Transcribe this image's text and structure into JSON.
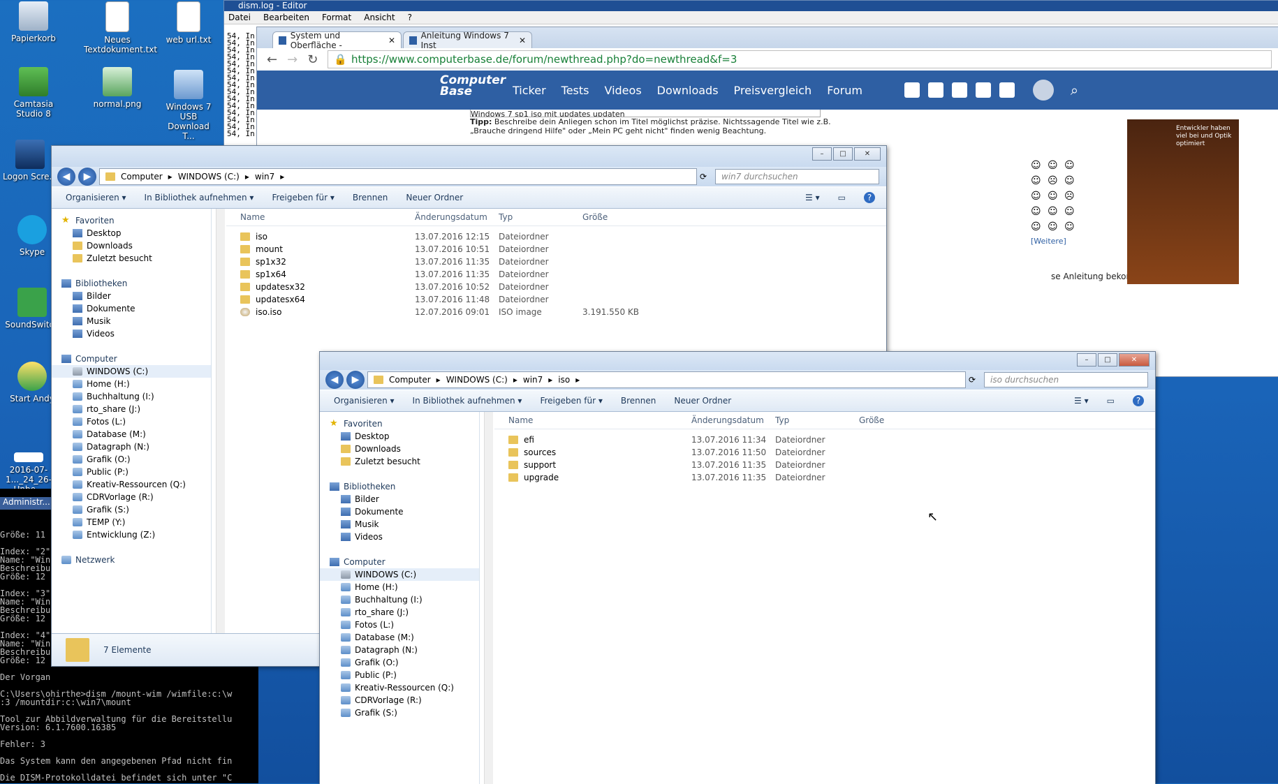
{
  "desktop_icons": [
    {
      "label": "Papierkorb"
    },
    {
      "label": "Neues Textdokument.txt"
    },
    {
      "label": "web url.txt"
    },
    {
      "label": "Camtasia Studio 8"
    },
    {
      "label": "normal.png"
    },
    {
      "label": "Windows 7 USB Download T..."
    },
    {
      "label": "Logon Scre..."
    },
    {
      "label": "Skype"
    },
    {
      "label": "SoundSwitch"
    },
    {
      "label": "Start Andy"
    },
    {
      "label": "2016-07-1..._24_26-Unbe..."
    }
  ],
  "editor": {
    "title": "dism.log - Editor",
    "menu": [
      "Datei",
      "Bearbeiten",
      "Format",
      "Ansicht",
      "?"
    ],
    "line_prefix": "54, In"
  },
  "browser": {
    "tabs": [
      {
        "label": "System und Oberfläche -"
      },
      {
        "label": "Anleitung Windows 7 Inst"
      }
    ],
    "url": "https://www.computerbase.de/forum/newthread.php?do=newthread&f=3",
    "nav_links": [
      "Ticker",
      "Tests",
      "Videos",
      "Downloads",
      "Preisvergleich",
      "Forum"
    ],
    "logo_text": "Computer Base",
    "tip_bold": "Tipp:",
    "tip_text": "Beschreibe dein Anliegen schon im Titel möglichst präzise. Nichtssagende Titel wie z.B. „Brauche dringend Hilfe\" oder „Mein PC geht nicht\" finden wenig Beachtung.",
    "thread_title": "Windows 7 sp1 iso mit updates updaten",
    "body_fragment": "se Anleitung bekomme ich",
    "more_smilies": "[Weitere]",
    "ad_headline": "Entwickler haben viel bei und Optik optimiert"
  },
  "console": {
    "title": "Administr...",
    "lines": [
      "Größe: 11",
      "",
      "Index: \"2\"",
      "Name: \"Win",
      "Beschreibu",
      "Größe: 12",
      "",
      "Index: \"3\"",
      "Name: \"Win",
      "Beschreibu",
      "Größe: 12",
      "",
      "Index: \"4\"",
      "Name: \"Win",
      "Beschreibu",
      "Größe: 12",
      "",
      "Der Vorgan",
      "",
      "C:\\Users\\ohirthe>dism /mount-wim /wimfile:c:\\w",
      ":3 /mountdir:c:\\win7\\mount",
      "",
      "Tool zur Abbildverwaltung für die Bereitstellu",
      "Version: 6.1.7600.16385",
      "",
      "Fehler: 3",
      "",
      "Das System kann den angegebenen Pfad nicht fin",
      "",
      "Die DISM-Protokolldatei befindet sich unter \"C"
    ]
  },
  "explorer_win7": {
    "breadcrumb": [
      "Computer",
      "WINDOWS (C:)",
      "win7"
    ],
    "search_placeholder": "win7 durchsuchen",
    "commands": [
      "Organisieren ▾",
      "In Bibliothek aufnehmen ▾",
      "Freigeben für ▾",
      "Brennen",
      "Neuer Ordner"
    ],
    "columns": {
      "name": "Name",
      "date": "Änderungsdatum",
      "type": "Typ",
      "size": "Größe"
    },
    "files": [
      {
        "name": "iso",
        "date": "13.07.2016 12:15",
        "type": "Dateiordner",
        "size": ""
      },
      {
        "name": "mount",
        "date": "13.07.2016 10:51",
        "type": "Dateiordner",
        "size": ""
      },
      {
        "name": "sp1x32",
        "date": "13.07.2016 11:35",
        "type": "Dateiordner",
        "size": ""
      },
      {
        "name": "sp1x64",
        "date": "13.07.2016 11:35",
        "type": "Dateiordner",
        "size": ""
      },
      {
        "name": "updatesx32",
        "date": "13.07.2016 10:52",
        "type": "Dateiordner",
        "size": ""
      },
      {
        "name": "updatesx64",
        "date": "13.07.2016 11:48",
        "type": "Dateiordner",
        "size": ""
      },
      {
        "name": "iso.iso",
        "date": "12.07.2016 09:01",
        "type": "ISO image",
        "size": "3.191.550 KB"
      }
    ],
    "status": "7 Elemente"
  },
  "explorer_iso": {
    "breadcrumb": [
      "Computer",
      "WINDOWS (C:)",
      "win7",
      "iso"
    ],
    "search_placeholder": "iso durchsuchen",
    "files": [
      {
        "name": "efi",
        "date": "13.07.2016 11:34",
        "type": "Dateiordner"
      },
      {
        "name": "sources",
        "date": "13.07.2016 11:50",
        "type": "Dateiordner"
      },
      {
        "name": "support",
        "date": "13.07.2016 11:35",
        "type": "Dateiordner"
      },
      {
        "name": "upgrade",
        "date": "13.07.2016 11:35",
        "type": "Dateiordner"
      }
    ]
  },
  "navpane": {
    "favorites": "Favoriten",
    "fav_items": [
      "Desktop",
      "Downloads",
      "Zuletzt besucht"
    ],
    "libraries": "Bibliotheken",
    "lib_items": [
      "Bilder",
      "Dokumente",
      "Musik",
      "Videos"
    ],
    "computer": "Computer",
    "drives": [
      "WINDOWS (C:)",
      "Home (H:)",
      "Buchhaltung (I:)",
      "rto_share (J:)",
      "Fotos (L:)",
      "Database (M:)",
      "Datagraph (N:)",
      "Grafik (O:)",
      "Public (P:)",
      "Kreativ-Ressourcen (Q:)",
      "CDRVorlage (R:)",
      "Grafik (S:)",
      "TEMP (Y:)",
      "Entwicklung (Z:)"
    ],
    "network": "Netzwerk"
  }
}
